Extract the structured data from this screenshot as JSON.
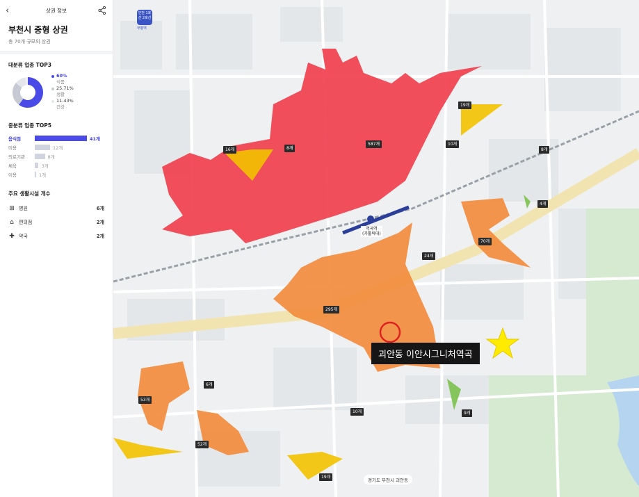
{
  "header": {
    "back_icon": "chevron-left-icon",
    "title": "상권 정보",
    "share_icon": "share-icon"
  },
  "area": {
    "name": "부천시 중형 상권",
    "subtitle": "총 70개 규모의 상권"
  },
  "top3": {
    "title": "대분류 업종 TOP3",
    "items": [
      {
        "percent": "60%",
        "name": "식품",
        "value": 60,
        "color": "#4a4ae6"
      },
      {
        "percent": "25.71%",
        "name": "생활",
        "value": 25.71,
        "color": "#c7c9d3"
      },
      {
        "percent": "11.43%",
        "name": "건강",
        "value": 11.43,
        "color": "#e4e6ec"
      }
    ]
  },
  "top5": {
    "title": "중분류 업종 TOP5",
    "max": 41,
    "items": [
      {
        "label": "음식점",
        "count": "41개",
        "value": 41
      },
      {
        "label": "미용",
        "count": "12개",
        "value": 12
      },
      {
        "label": "의료기관",
        "count": "8개",
        "value": 8
      },
      {
        "label": "체육",
        "count": "3개",
        "value": 3
      },
      {
        "label": "이용",
        "count": "1개",
        "value": 1
      }
    ]
  },
  "facilities": {
    "title": "주요 생활시설 개수",
    "items": [
      {
        "icon": "hospital-icon",
        "label": "병원",
        "count": "6개"
      },
      {
        "icon": "store-icon",
        "label": "편의점",
        "count": "2개"
      },
      {
        "icon": "pharmacy-icon",
        "label": "약국",
        "count": "2개"
      }
    ]
  },
  "map": {
    "line_badge": "인천 1호선 2호선",
    "line_badge_sub": "부평역",
    "station": {
      "name": "역곡역",
      "sub": "(가톨릭대)"
    },
    "callout": "괴안동 이안시그니처역곡",
    "address": "경기도 부천시 괴안동",
    "zone_labels": [
      "587개",
      "295개",
      "70개",
      "53개",
      "52개",
      "19개",
      "16개",
      "8개",
      "10개",
      "24개",
      "6개",
      "10개",
      "9개",
      "19개",
      "8개",
      "4개"
    ],
    "colors": {
      "red": "#f03c4a",
      "orange": "#f28a3a",
      "yellow": "#f2c200",
      "green": "#7ac14b",
      "line": "#2b3f9a",
      "star": "#ffeb00",
      "marker": "#e02020"
    }
  }
}
